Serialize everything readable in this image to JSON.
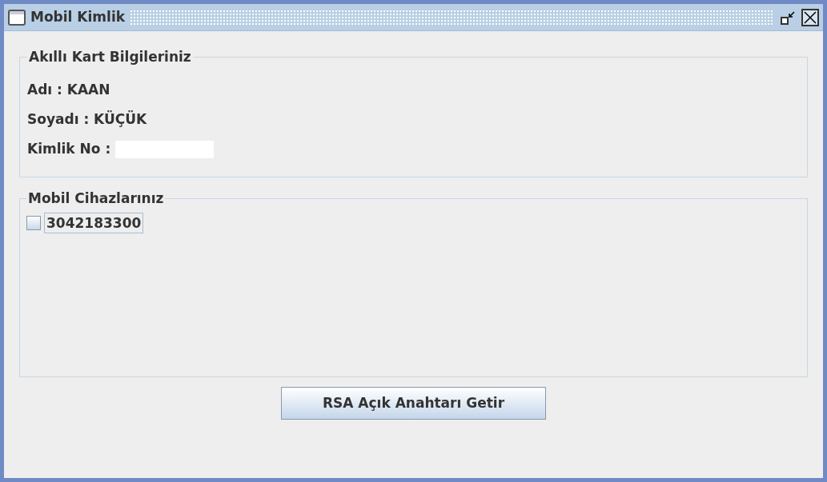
{
  "window": {
    "title": "Mobil Kimlik"
  },
  "card_info": {
    "title": "Akıllı Kart Bilgileriniz",
    "fields": [
      {
        "kind": "text",
        "label": "Adı : KAAN"
      },
      {
        "kind": "text",
        "label": "Soyadı : KÜÇÜK"
      },
      {
        "kind": "input",
        "label": "Kimlik No :"
      }
    ]
  },
  "devices": {
    "title": "Mobil Cihazlarınız",
    "items": [
      {
        "label": "3042183300",
        "checked": false
      }
    ]
  },
  "buttons": [
    "RSA Açık Anahtarı Getir"
  ]
}
